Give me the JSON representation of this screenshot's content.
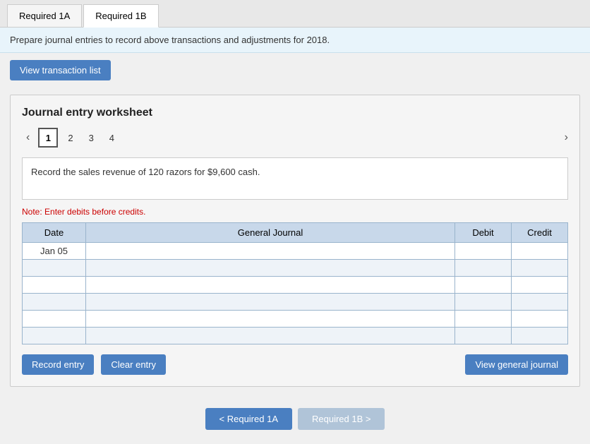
{
  "tabs": [
    {
      "id": "tab1a",
      "label": "Required 1A",
      "active": false
    },
    {
      "id": "tab1b",
      "label": "Required 1B",
      "active": true
    }
  ],
  "info_bar": {
    "text": "Prepare journal entries to record above transactions and adjustments for 2018."
  },
  "view_transaction_btn": "View transaction list",
  "worksheet": {
    "title": "Journal entry worksheet",
    "pages": [
      "1",
      "2",
      "3",
      "4"
    ],
    "current_page": "1",
    "description": "Record the sales revenue of 120 razors for $9,600 cash.",
    "note": "Note: Enter debits before credits.",
    "table": {
      "headers": [
        "Date",
        "General Journal",
        "Debit",
        "Credit"
      ],
      "rows": [
        {
          "date": "Jan 05",
          "journal": "",
          "debit": "",
          "credit": ""
        },
        {
          "date": "",
          "journal": "",
          "debit": "",
          "credit": ""
        },
        {
          "date": "",
          "journal": "",
          "debit": "",
          "credit": ""
        },
        {
          "date": "",
          "journal": "",
          "debit": "",
          "credit": ""
        },
        {
          "date": "",
          "journal": "",
          "debit": "",
          "credit": ""
        },
        {
          "date": "",
          "journal": "",
          "debit": "",
          "credit": ""
        }
      ]
    },
    "buttons": {
      "record": "Record entry",
      "clear": "Clear entry",
      "view_journal": "View general journal"
    }
  },
  "bottom_nav": {
    "prev_label": "< Required 1A",
    "next_label": "Required 1B >"
  }
}
